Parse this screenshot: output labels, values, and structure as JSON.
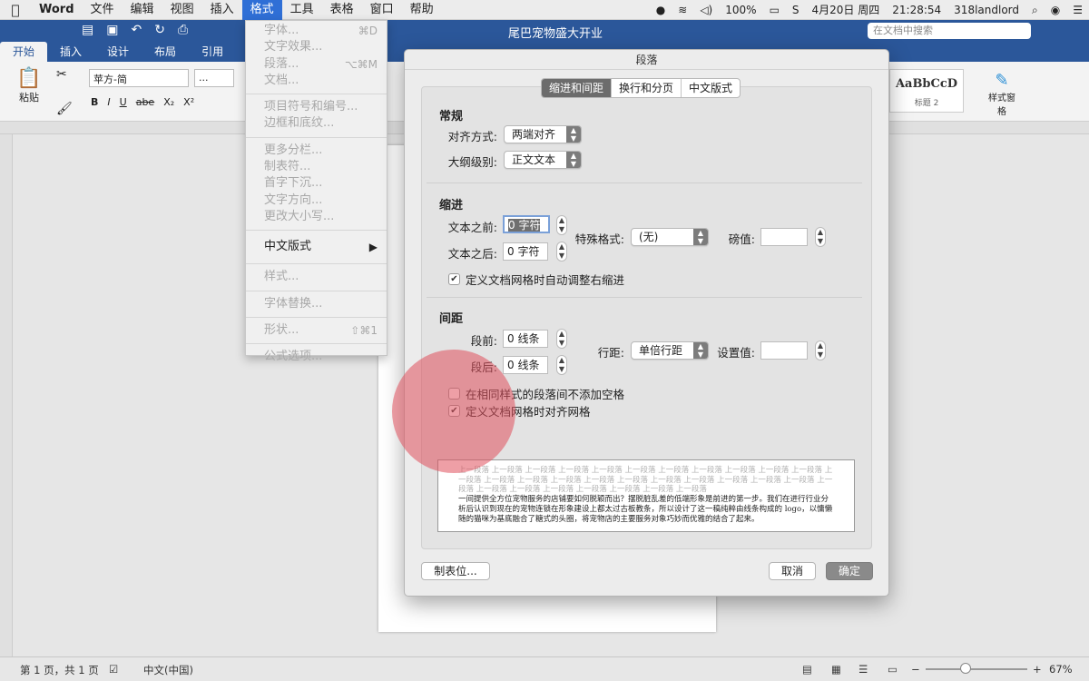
{
  "menubar": {
    "app": "Word",
    "items": [
      "文件",
      "编辑",
      "视图",
      "插入",
      "格式",
      "工具",
      "表格",
      "窗口",
      "帮助"
    ],
    "battery": "100%",
    "date": "4月20日 周四",
    "time": "21:28:54",
    "user": "318landlord"
  },
  "window": {
    "doc_title": "尾巴宠物盛大开业",
    "search_placeholder": "在文档中搜索"
  },
  "ribbon": {
    "tabs": [
      "开始",
      "插入",
      "设计",
      "布局",
      "引用"
    ],
    "paste_label": "粘贴",
    "font_name": "苹方-简",
    "font_size": "...",
    "format_buttons": [
      "B",
      "I",
      "U",
      "abe",
      "X₂",
      "X²"
    ],
    "style_sample": "AaBbCcD",
    "style_label": "标题 2",
    "style_pane_label": "样式窗格"
  },
  "format_menu": {
    "items": [
      {
        "label": "字体...",
        "shortcut": "⌘D"
      },
      {
        "label": "文字效果...",
        "shortcut": ""
      },
      {
        "label": "段落...",
        "shortcut": "⌥⌘M"
      },
      {
        "label": "文档...",
        "shortcut": ""
      },
      {
        "label": "项目符号和编号...",
        "shortcut": ""
      },
      {
        "label": "边框和底纹...",
        "shortcut": ""
      },
      {
        "label": "更多分栏...",
        "shortcut": ""
      },
      {
        "label": "制表符...",
        "shortcut": ""
      },
      {
        "label": "首字下沉...",
        "shortcut": ""
      },
      {
        "label": "文字方向...",
        "shortcut": ""
      },
      {
        "label": "更改大小写...",
        "shortcut": ""
      },
      {
        "label": "中文版式",
        "shortcut": "▶"
      },
      {
        "label": "样式...",
        "shortcut": ""
      },
      {
        "label": "字体替换...",
        "shortcut": ""
      },
      {
        "label": "形状...",
        "shortcut": "⇧⌘1"
      },
      {
        "label": "公式选项...",
        "shortcut": ""
      }
    ]
  },
  "dialog": {
    "title": "段落",
    "tabs": [
      "缩进和间距",
      "换行和分页",
      "中文版式"
    ],
    "general": {
      "heading": "常规",
      "alignment_label": "对齐方式:",
      "alignment_value": "两端对齐",
      "outline_label": "大纲级别:",
      "outline_value": "正文文本"
    },
    "indent": {
      "heading": "缩进",
      "before_label": "文本之前:",
      "before_value": "0 字符",
      "after_label": "文本之后:",
      "after_value": "0 字符",
      "special_label": "特殊格式:",
      "special_value": "(无)",
      "by_label": "磅值:",
      "by_value": "",
      "auto_adjust": "定义文档网格时自动调整右缩进"
    },
    "spacing": {
      "heading": "间距",
      "before_label": "段前:",
      "before_value": "0 线条",
      "after_label": "段后:",
      "after_value": "0 线条",
      "line_label": "行距:",
      "line_value": "单倍行距",
      "at_label": "设置值:",
      "at_value": "",
      "no_space_same_style": "在相同样式的段落间不添加空格",
      "snap_to_grid": "定义文档网格时对齐网格"
    },
    "preview": {
      "prev_text": "上一段落 上一段落 上一段落 上一段落 上一段落 上一段落 上一段落 上一段落 上一段落 上一段落 上一段落 上一段落 上一段落 上一段落 上一段落 上一段落 上一段落 上一段落 上一段落 上一段落 上一段落 上一段落 上一段落 上一段落 上一段落 上一段落 上一段落 上一段落 上一段落 上一段落",
      "current_text": "一间提供全方位宠物服务的店铺要如何脱颖而出？摆脱脏乱差的低端形象是前进的第一步。我们在进行行业分析后认识到现在的宠物连锁在形象建设上都太过古板教条，所以设计了这一稿纯粹由线条构成的 logo，以慵懒随的猫咪为基底融合了糖式的头圈，将宠物店的主要服务对象巧妙而优雅的结合了起来。"
    },
    "tabs_button": "制表位...",
    "cancel": "取消",
    "ok": "确定"
  },
  "statusbar": {
    "page_info": "第 1 页，共 1 页",
    "language": "中文(中国)",
    "zoom": "67%"
  },
  "colors": {
    "word_blue": "#2b579a",
    "highlight": "#e0505c",
    "menu_active": "#2f6fd6"
  }
}
